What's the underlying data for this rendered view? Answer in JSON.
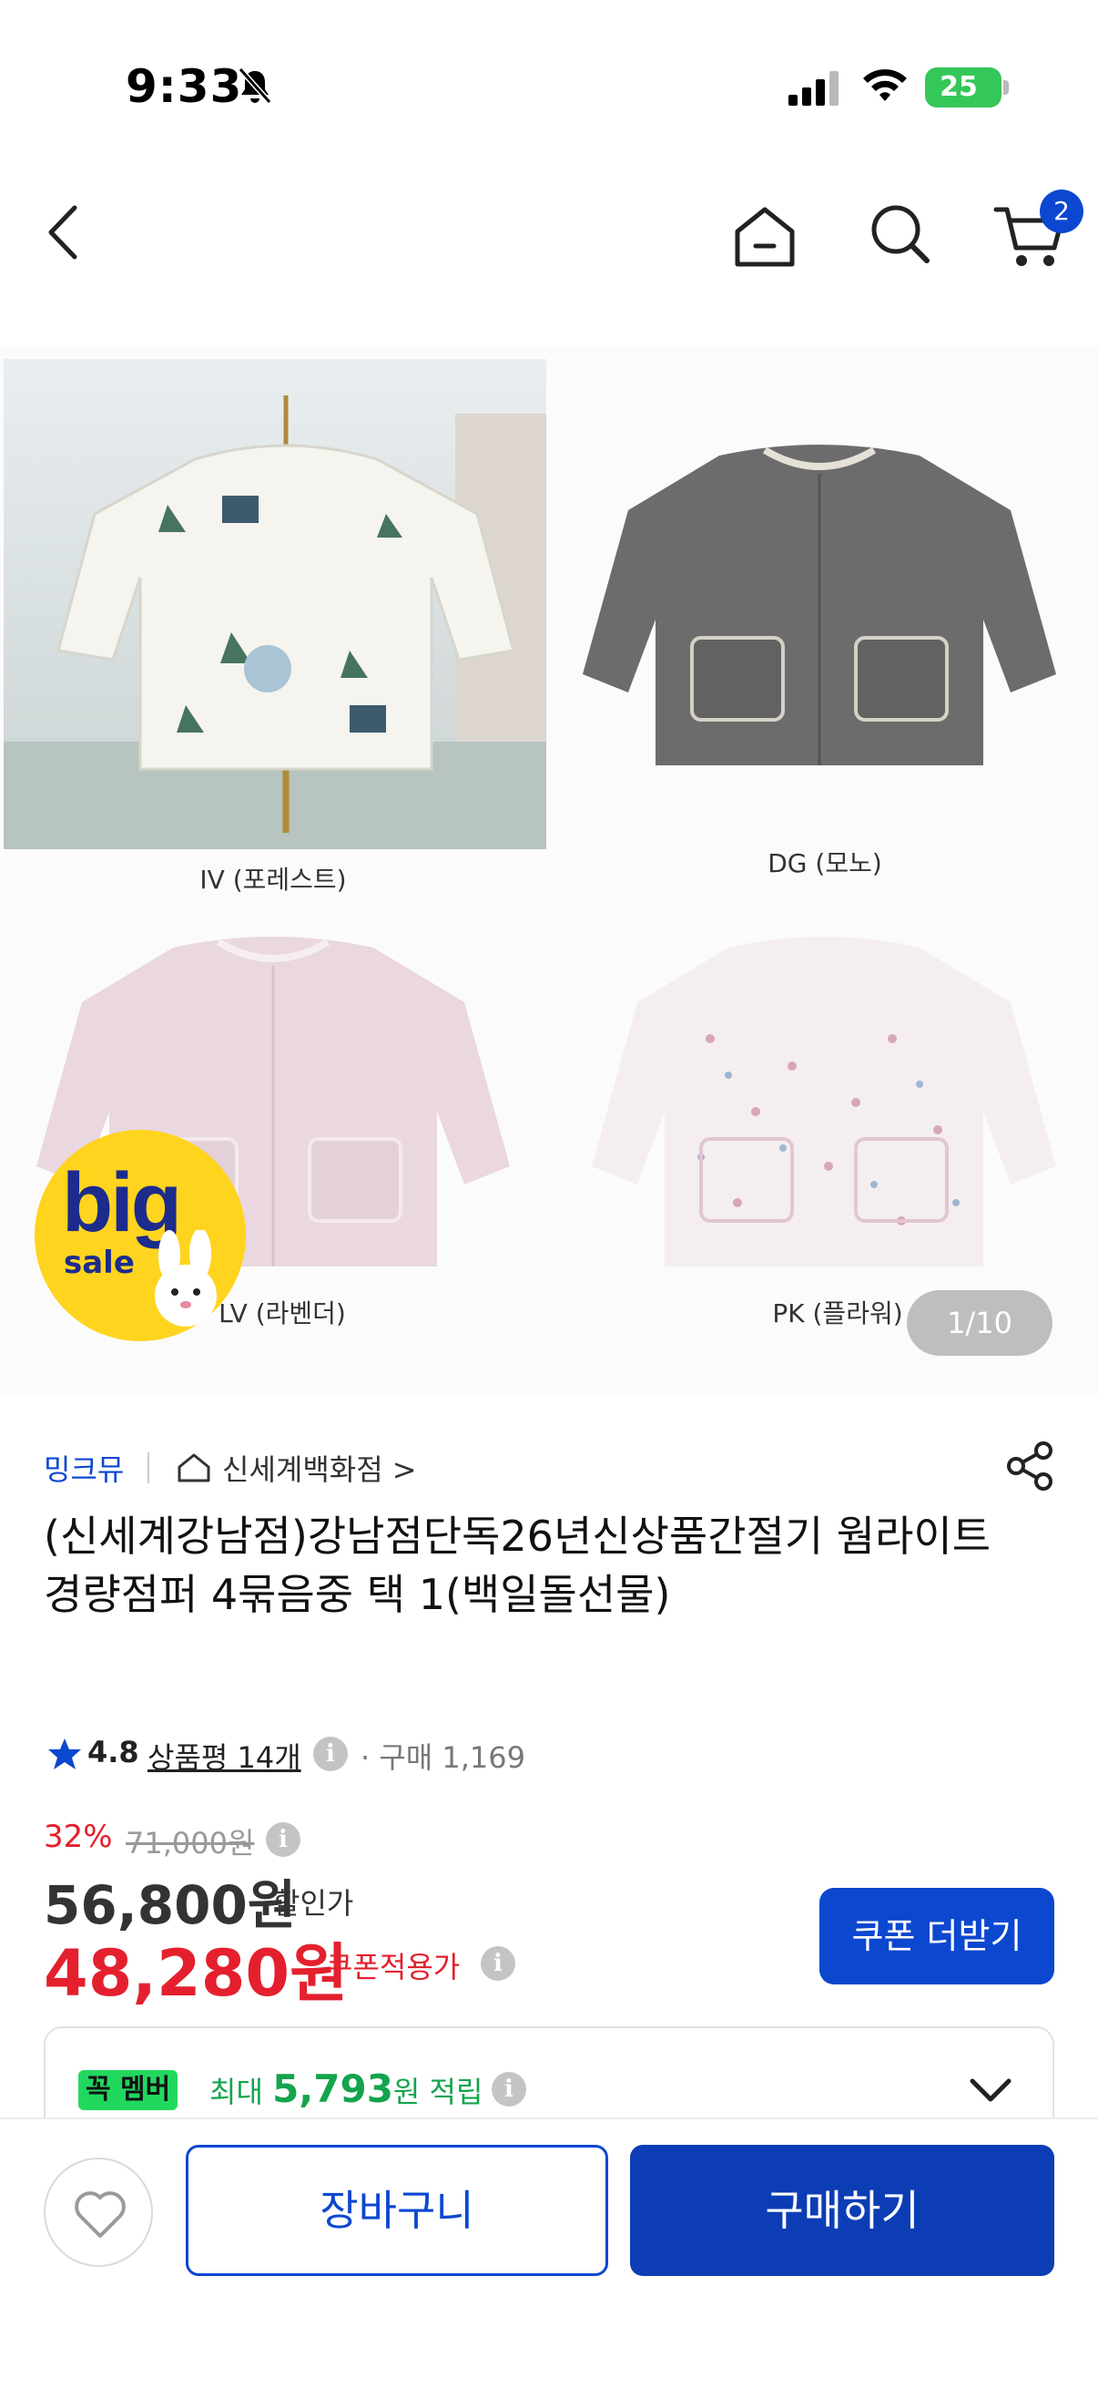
{
  "status_bar": {
    "time": "9:33",
    "battery": "25"
  },
  "header": {
    "cart_count": "2"
  },
  "product_image": {
    "labels": [
      "IV (포레스트)",
      "DG (모노)",
      "LV (라벤더)",
      "PK (플라워)"
    ],
    "badge_big": "big",
    "badge_sale": "sale",
    "counter": "1/10"
  },
  "brand_row": {
    "brand": "밍크뮤",
    "store": "신세계백화점 >"
  },
  "product": {
    "title": "(신세계강남점)강남점단독26년신상품간절기 웜라이트 경량점퍼  4묶음중 택 1(백일돌선물)",
    "rating": "4.8",
    "reviews": "상품평 14개",
    "purchases": "· 구매 1,169"
  },
  "price": {
    "discount_pct": "32%",
    "original": "71,000원",
    "sale_price": "56,800원",
    "sale_label": "할인가",
    "coupon_price": "48,280원",
    "coupon_label": "쿠폰적용가",
    "coupon_button": "쿠폰 더받기"
  },
  "member": {
    "logo": "꼭 멤버",
    "prefix": "최대 ",
    "amount": "5,793",
    "suffix": "원 적립"
  },
  "bottom_bar": {
    "cart_label": "장바구니",
    "buy_label": "구매하기"
  },
  "colors": {
    "accent": "#0c47d0",
    "price_red": "#e4202e",
    "member_green": "#21d85f"
  }
}
